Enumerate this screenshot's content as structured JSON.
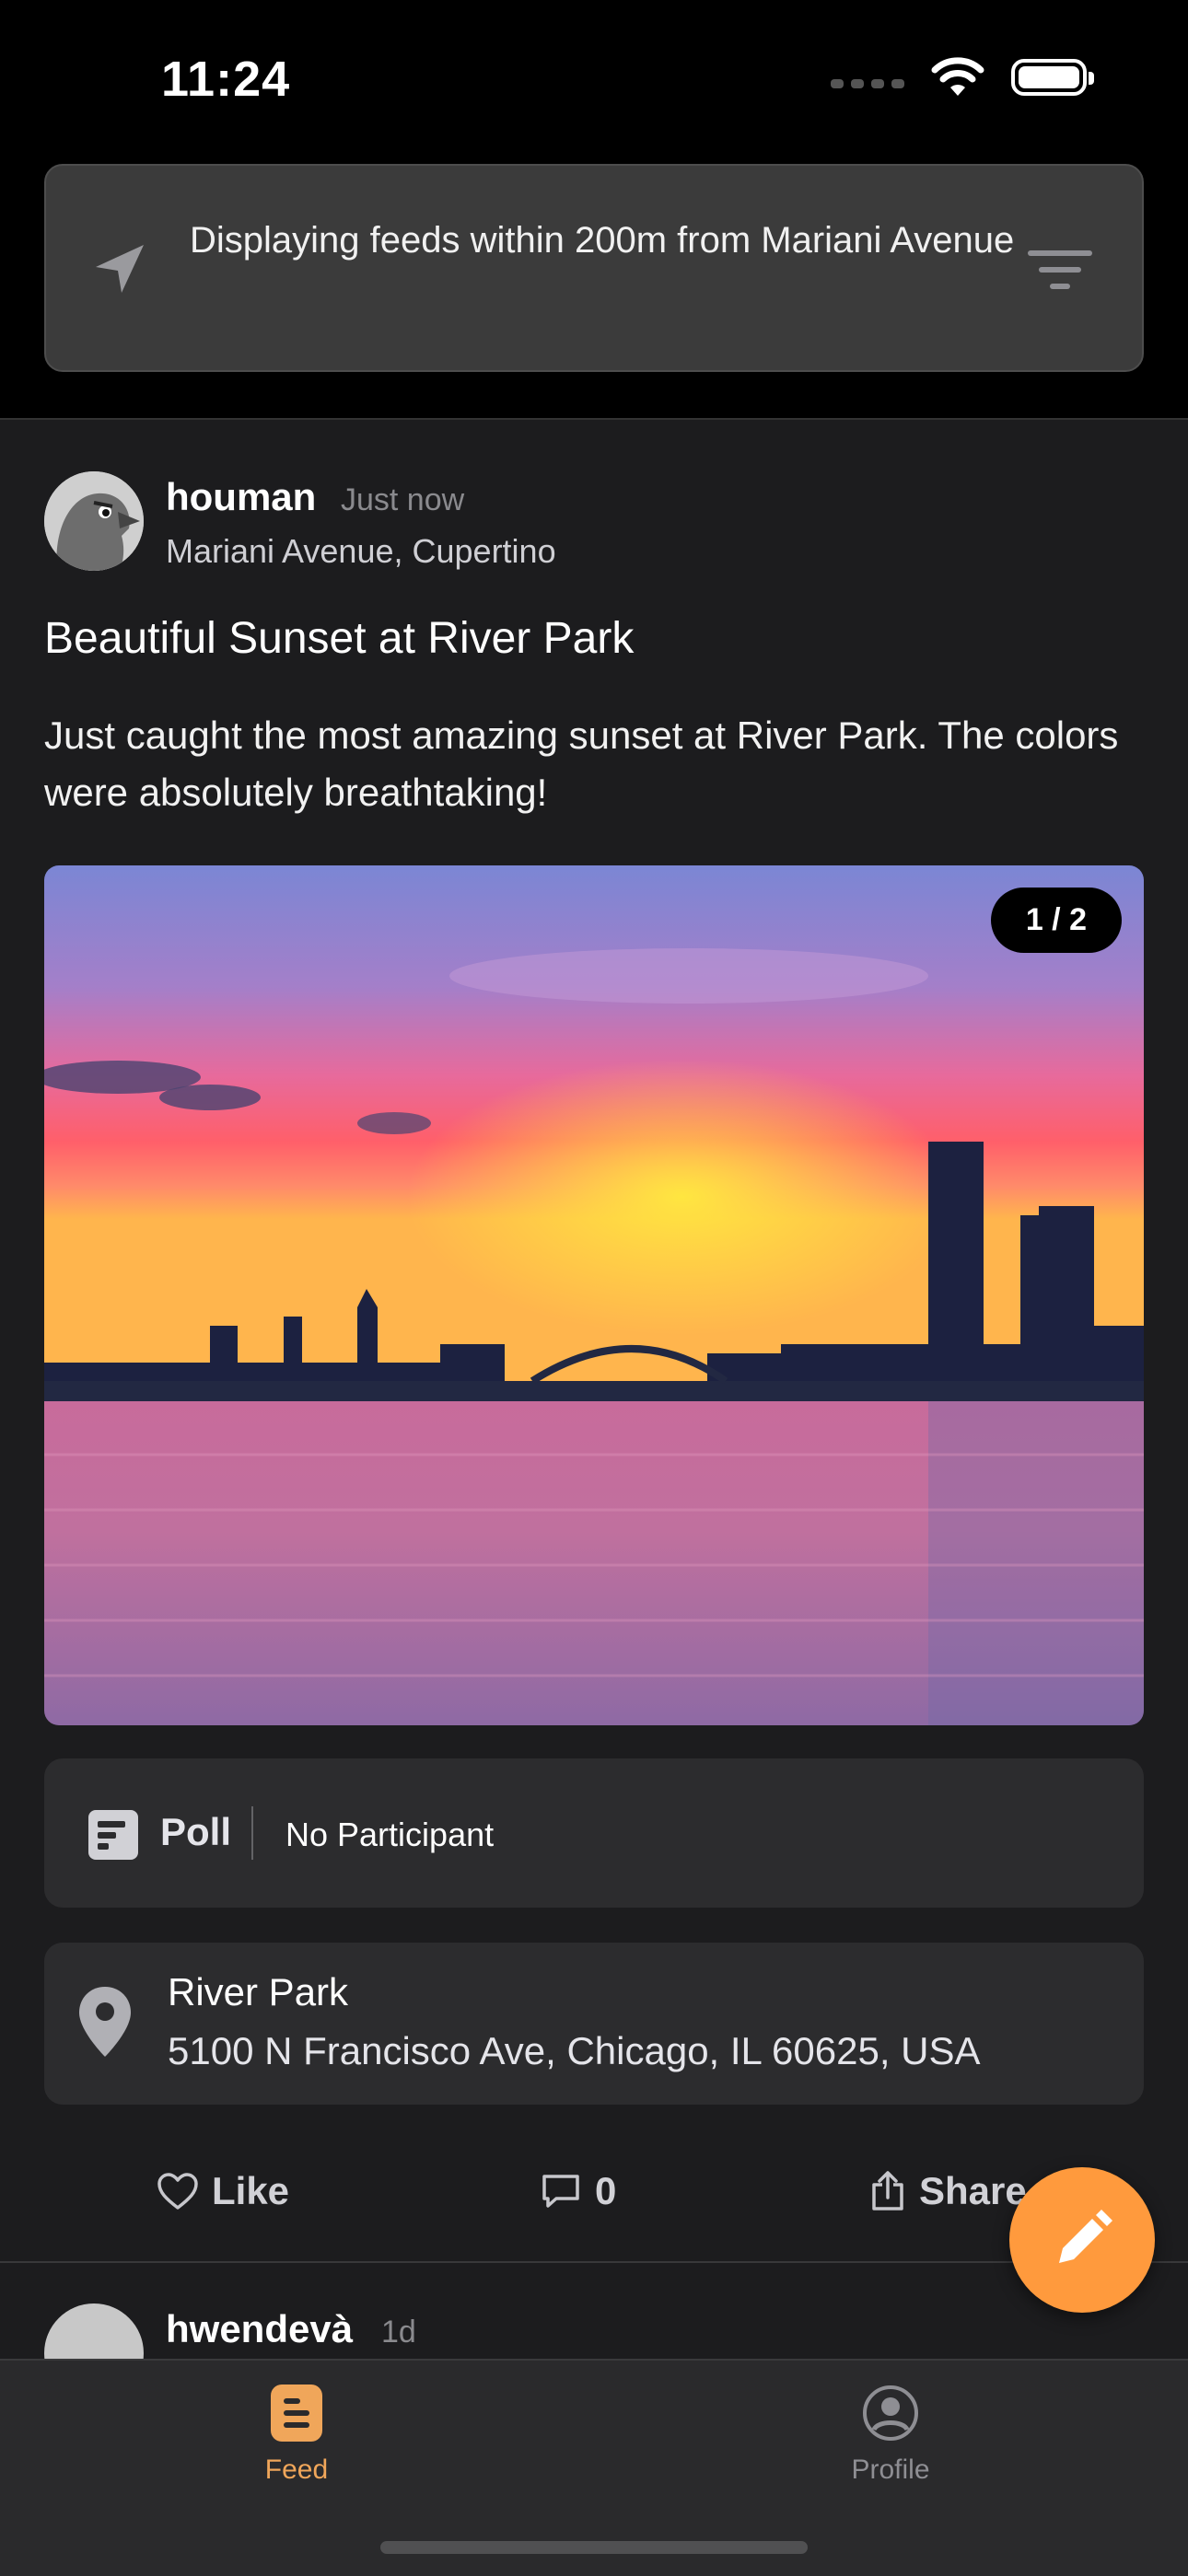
{
  "status_bar": {
    "time": "11:24"
  },
  "location_banner": {
    "text": "Displaying feeds within 200m from Mariani Avenue"
  },
  "post": {
    "username": "houman",
    "posted_time": "Just now",
    "location": "Mariani Avenue, Cupertino",
    "title": "Beautiful Sunset at River Park",
    "body": "Just caught the most amazing sunset at River Park. The colors were absolutely breathtaking!",
    "image_counter": "1 / 2",
    "poll": {
      "label": "Poll",
      "status": "No Participant"
    },
    "place": {
      "name": "River Park",
      "address": "5100 N Francisco Ave, Chicago, IL 60625, USA"
    },
    "actions": {
      "like_label": "Like",
      "comment_count": "0",
      "share_label": "Share"
    }
  },
  "next_post": {
    "username": "hwendevà",
    "posted_time": "1d"
  },
  "tab_bar": {
    "tabs": [
      {
        "label": "Feed",
        "active": true,
        "icon": "feed-icon"
      },
      {
        "label": "Profile",
        "active": false,
        "icon": "profile-icon"
      }
    ]
  },
  "colors": {
    "accent": "#ff9a3d",
    "background": "#1c1c1e",
    "card": "#2c2c2e"
  }
}
